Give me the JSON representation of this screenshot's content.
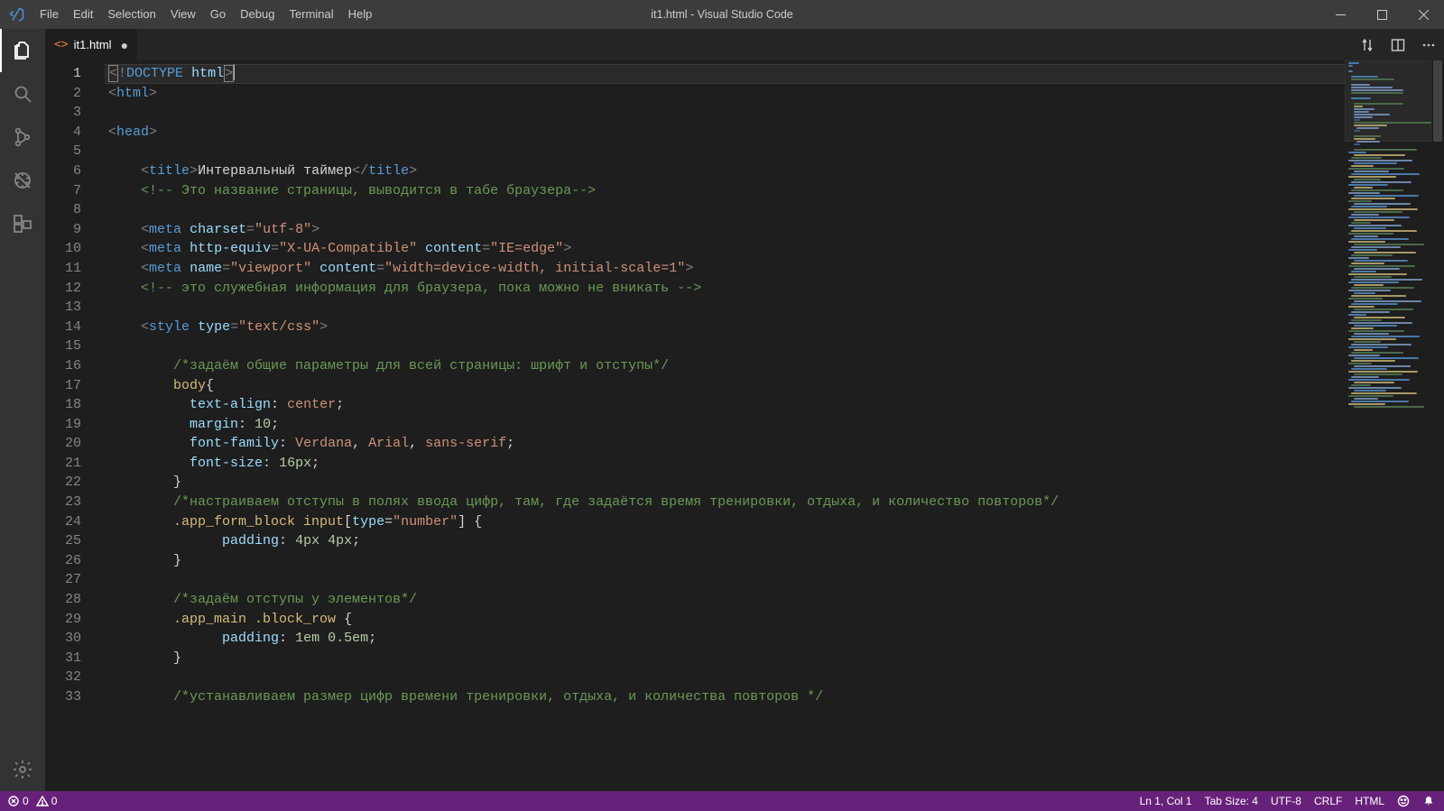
{
  "window": {
    "title": "it1.html - Visual Studio Code"
  },
  "menu": [
    "File",
    "Edit",
    "Selection",
    "View",
    "Go",
    "Debug",
    "Terminal",
    "Help"
  ],
  "activity": [
    {
      "name": "files-icon",
      "active": true
    },
    {
      "name": "search-icon",
      "active": false
    },
    {
      "name": "git-icon",
      "active": false
    },
    {
      "name": "debug-icon",
      "active": false
    },
    {
      "name": "extensions-icon",
      "active": false
    }
  ],
  "tabs": {
    "items": [
      {
        "label": "it1.html",
        "icon": "<>",
        "dirty": true
      }
    ]
  },
  "editor": {
    "filename": "it1.html",
    "lines": [
      {
        "n": 1,
        "ind": 0,
        "kind": "doctype"
      },
      {
        "n": 2,
        "ind": 0,
        "kind": "tag-open",
        "tag": "html"
      },
      {
        "n": 3,
        "ind": 0,
        "kind": "blank"
      },
      {
        "n": 4,
        "ind": 0,
        "kind": "tag-open",
        "tag": "head"
      },
      {
        "n": 5,
        "ind": 0,
        "kind": "blank"
      },
      {
        "n": 6,
        "ind": 1,
        "kind": "title",
        "text": "Интервальный таймер"
      },
      {
        "n": 7,
        "ind": 1,
        "kind": "html-comment",
        "text": " Это название страницы, выводится в табе браузера"
      },
      {
        "n": 8,
        "ind": 1,
        "kind": "blank"
      },
      {
        "n": 9,
        "ind": 1,
        "kind": "meta",
        "attrs": [
          [
            "charset",
            "utf-8"
          ]
        ]
      },
      {
        "n": 10,
        "ind": 1,
        "kind": "meta",
        "attrs": [
          [
            "http-equiv",
            "X-UA-Compatible"
          ],
          [
            "content",
            "IE=edge"
          ]
        ]
      },
      {
        "n": 11,
        "ind": 1,
        "kind": "meta",
        "attrs": [
          [
            "name",
            "viewport"
          ],
          [
            "content",
            "width=device-width, initial-scale=1"
          ]
        ]
      },
      {
        "n": 12,
        "ind": 1,
        "kind": "html-comment",
        "text": " это служебная информация для браузера, пока можно не вникать "
      },
      {
        "n": 13,
        "ind": 0,
        "kind": "blank"
      },
      {
        "n": 14,
        "ind": 1,
        "kind": "style-open"
      },
      {
        "n": 15,
        "ind": 0,
        "kind": "blank"
      },
      {
        "n": 16,
        "ind": 2,
        "kind": "css-comment",
        "text": "задаём общие параметры для всей страницы: шрифт и отступы"
      },
      {
        "n": 17,
        "ind": 2,
        "kind": "css-sel-open",
        "sel": "body"
      },
      {
        "n": 18,
        "ind": 2,
        "kind": "css-decl",
        "prop": "text-align",
        "val_kw": "center"
      },
      {
        "n": 19,
        "ind": 2,
        "kind": "css-decl",
        "prop": "margin",
        "val_num": "10"
      },
      {
        "n": 20,
        "ind": 2,
        "kind": "css-decl",
        "prop": "font-family",
        "val_list": [
          "Verdana",
          "Arial",
          "sans-serif"
        ]
      },
      {
        "n": 21,
        "ind": 2,
        "kind": "css-decl",
        "prop": "font-size",
        "val_num": "16px"
      },
      {
        "n": 22,
        "ind": 2,
        "kind": "css-close"
      },
      {
        "n": 23,
        "ind": 2,
        "kind": "css-comment",
        "text": "настраиваем отступы в полях ввода цифр, там, где задаётся время тренировки, отдыха, и количество повторов"
      },
      {
        "n": 24,
        "ind": 2,
        "kind": "css-sel-open-attr",
        "sel": ".app_form_block input",
        "akey": "type",
        "aval": "number"
      },
      {
        "n": 25,
        "ind": 3,
        "kind": "css-decl",
        "prop": "padding",
        "val_num": "4px 4px"
      },
      {
        "n": 26,
        "ind": 2,
        "kind": "css-close"
      },
      {
        "n": 27,
        "ind": 0,
        "kind": "blank"
      },
      {
        "n": 28,
        "ind": 2,
        "kind": "css-comment",
        "text": "задаём отступы у элементов"
      },
      {
        "n": 29,
        "ind": 2,
        "kind": "css-sel-open",
        "sel": ".app_main .block_row",
        "space_before_brace": true
      },
      {
        "n": 30,
        "ind": 3,
        "kind": "css-decl",
        "prop": "padding",
        "val_num": "1em 0.5em"
      },
      {
        "n": 31,
        "ind": 2,
        "kind": "css-close"
      },
      {
        "n": 32,
        "ind": 0,
        "kind": "blank"
      },
      {
        "n": 33,
        "ind": 2,
        "kind": "css-comment",
        "text": "устанавливаем размер цифр времени тренировки, отдыха, и количества повторов "
      }
    ],
    "current_line": 1
  },
  "status": {
    "errors": 0,
    "warnings": 0,
    "line": 1,
    "col": 1,
    "ln_col": "Ln 1, Col 1",
    "tab_size": "Tab Size: 4",
    "encoding": "UTF-8",
    "eol": "CRLF",
    "language": "HTML"
  }
}
